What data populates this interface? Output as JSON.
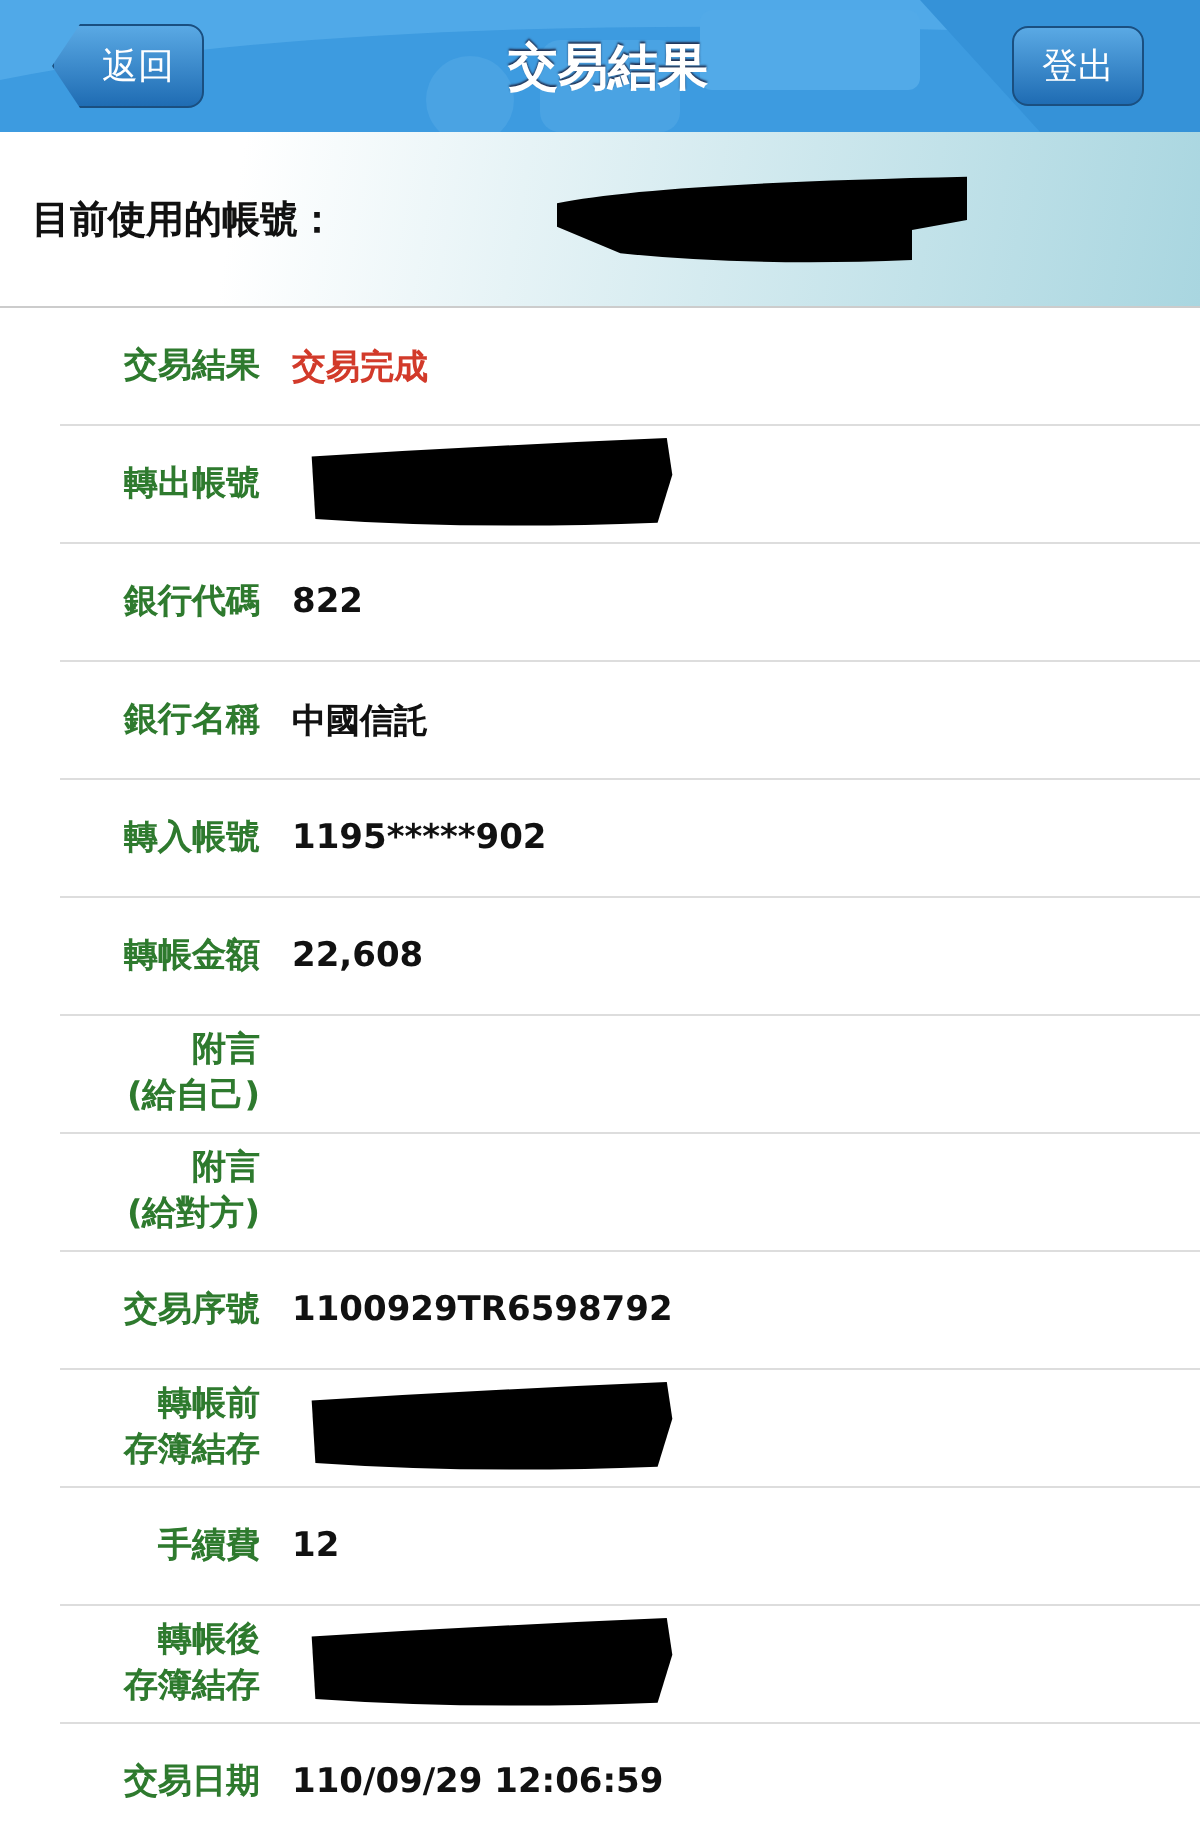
{
  "nav_bar": {
    "back_button": "返回",
    "title": "交易結果",
    "logout_button": "登出"
  },
  "account_bar": {
    "label": "目前使用的帳號：",
    "redacted": true
  },
  "rows": [
    {
      "label": [
        "交易結果"
      ],
      "value": "交易完成",
      "highlight": true
    },
    {
      "label": [
        "轉出帳號"
      ],
      "redacted": true
    },
    {
      "label": [
        "銀行代碼"
      ],
      "value": "822",
      "highlight": false
    },
    {
      "label": [
        "銀行名稱"
      ],
      "value": "中國信託",
      "highlight": false
    },
    {
      "label": [
        "轉入帳號"
      ],
      "value": "1195*****902",
      "highlight": false
    },
    {
      "label": [
        "轉帳金額"
      ],
      "value": "22,608",
      "highlight": false
    },
    {
      "label": [
        "附言",
        "(給自己)"
      ]
    },
    {
      "label": [
        "附言",
        "(給對方)"
      ]
    },
    {
      "label": [
        "交易序號"
      ],
      "value": "1100929TR6598792",
      "highlight": false
    },
    {
      "label": [
        "轉帳前",
        "存簿結存"
      ],
      "redacted": true
    },
    {
      "label": [
        "手續費"
      ],
      "value": "12",
      "highlight": false
    },
    {
      "label": [
        "轉帳後",
        "存簿結存"
      ],
      "redacted": true
    },
    {
      "label": [
        "交易日期"
      ],
      "value": "110/09/29 12:06:59",
      "highlight": false
    }
  ]
}
